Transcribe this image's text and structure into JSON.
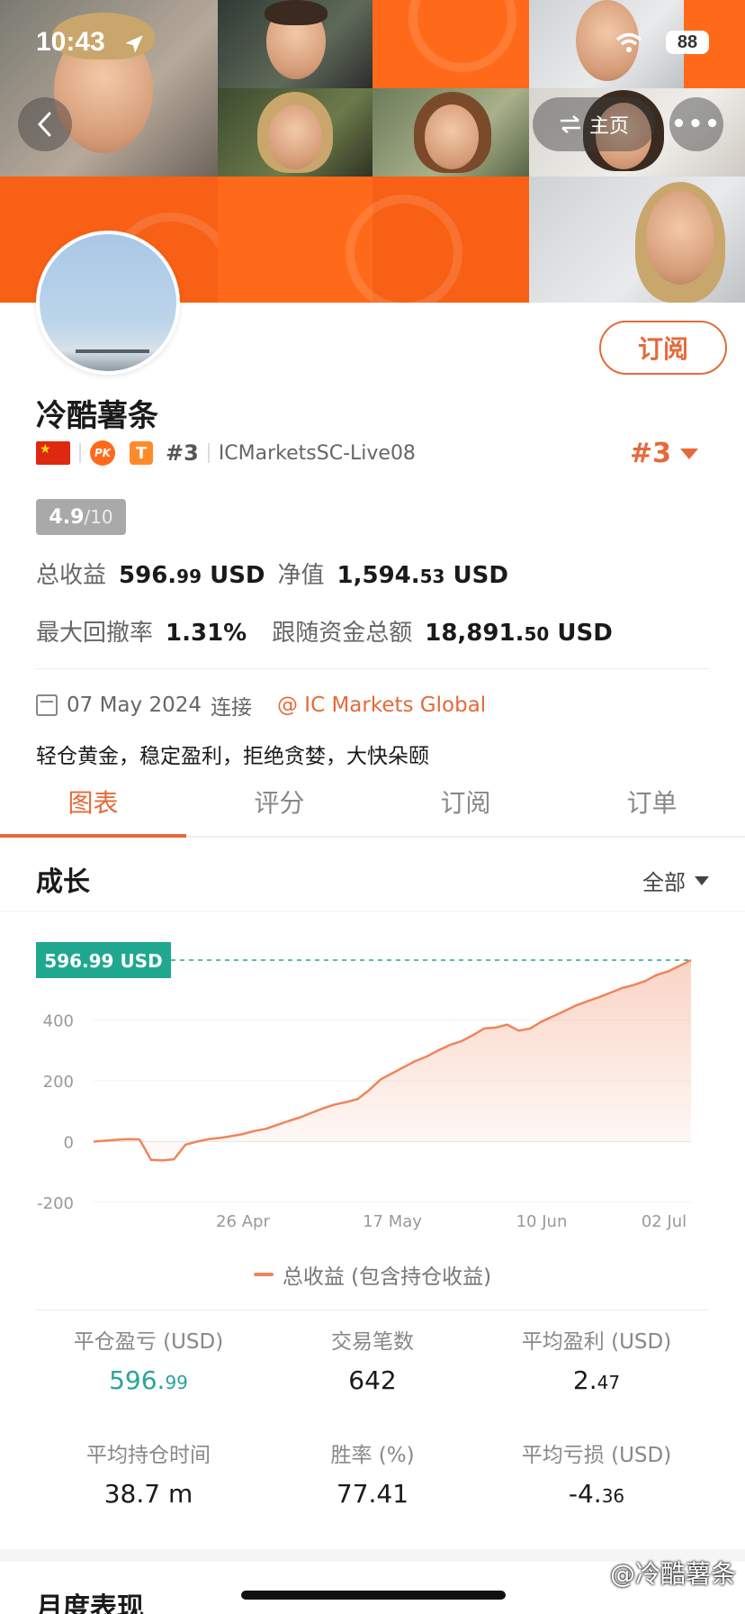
{
  "status_bar": {
    "time": "10:43",
    "battery": "88"
  },
  "nav": {
    "home_label": "主页",
    "more_label": "•••"
  },
  "profile": {
    "subscribe_label": "订阅",
    "name": "冷酷薯条",
    "rank_small": "#3",
    "account": "ICMarketsSC-Live08",
    "rank_big": "#3",
    "badges": {
      "pk": "PK",
      "t": "T"
    },
    "score": "4.9",
    "score_denominator": "/10"
  },
  "stats_top": {
    "total_profit_label": "总收益",
    "total_profit_int": "596.",
    "total_profit_dec": "99",
    "total_profit_unit": "USD",
    "equity_label": "净值",
    "equity_int": "1,594.",
    "equity_dec": "53",
    "equity_unit": "USD",
    "drawdown_label": "最大回撤率",
    "drawdown_value": "1.31%",
    "follow_label": "跟随资金总额",
    "follow_int": "18,891.",
    "follow_dec": "50",
    "follow_unit": "USD"
  },
  "connect": {
    "date": "07 May 2024",
    "suffix": "连接",
    "broker": "@ IC Markets Global"
  },
  "description": "轻仓黄金，稳定盈利，拒绝贪婪，大快朵颐",
  "tabs": [
    "图表",
    "评分",
    "订阅",
    "订单"
  ],
  "section": {
    "title": "成长",
    "filter": "全部"
  },
  "chart_data": {
    "type": "area",
    "current_label": "596.99 USD",
    "current_value": 596.99,
    "ylim": [
      -200,
      650
    ],
    "y_ticks": [
      400,
      200,
      0,
      -200
    ],
    "x_tick_labels": [
      "26 Apr",
      "17 May",
      "10 Jun",
      "02 Jul"
    ],
    "series": [
      {
        "name": "总收益 (包含持仓收益)",
        "values": [
          0,
          3,
          6,
          8,
          7,
          -60,
          -62,
          -58,
          -10,
          0,
          8,
          12,
          18,
          25,
          35,
          42,
          55,
          68,
          80,
          95,
          110,
          122,
          130,
          140,
          170,
          205,
          225,
          245,
          265,
          280,
          300,
          318,
          330,
          350,
          372,
          375,
          385,
          365,
          372,
          395,
          412,
          430,
          448,
          462,
          475,
          490,
          505,
          515,
          528,
          548,
          560,
          578,
          596.99
        ]
      }
    ],
    "accent_color": "#f0845a",
    "label_color": "#1fa88f"
  },
  "stats_grid": [
    {
      "label": "平仓盈亏 (USD)",
      "int": "596.",
      "dec": "99",
      "green": true
    },
    {
      "label": "交易笔数",
      "int": "642",
      "dec": "",
      "green": false
    },
    {
      "label": "平均盈利 (USD)",
      "int": "2.",
      "dec": "47",
      "green": false
    },
    {
      "label": "平均持仓时间",
      "int": "38.7 m",
      "dec": "",
      "green": false
    },
    {
      "label": "胜率 (%)",
      "int": "77.41",
      "dec": "",
      "green": false
    },
    {
      "label": "平均亏损 (USD)",
      "int": "-4.",
      "dec": "36",
      "green": false
    }
  ],
  "next_section_title": "月度表现",
  "watermark": "@冷酷薯条"
}
